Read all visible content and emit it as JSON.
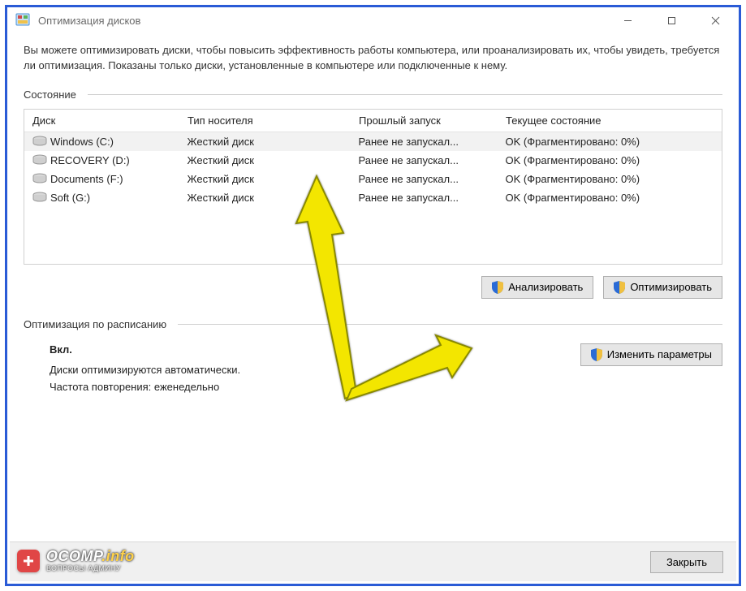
{
  "window": {
    "title": "Оптимизация дисков"
  },
  "intro": "Вы можете оптимизировать диски, чтобы повысить эффективность работы  компьютера, или проанализировать их, чтобы увидеть, требуется ли оптимизация. Показаны только диски, установленные в компьютере или подключенные к нему.",
  "section_state_label": "Состояние",
  "columns": {
    "disk": "Диск",
    "media": "Тип носителя",
    "last_run": "Прошлый запуск",
    "status": "Текущее состояние"
  },
  "drives": [
    {
      "name": "Windows (C:)",
      "media": "Жесткий диск",
      "last_run": "Ранее не запускал...",
      "status": "OK (Фрагментировано: 0%)",
      "selected": true
    },
    {
      "name": "RECOVERY (D:)",
      "media": "Жесткий диск",
      "last_run": "Ранее не запускал...",
      "status": "OK (Фрагментировано: 0%)",
      "selected": false
    },
    {
      "name": "Documents (F:)",
      "media": "Жесткий диск",
      "last_run": "Ранее не запускал...",
      "status": "OK (Фрагментировано: 0%)",
      "selected": false
    },
    {
      "name": "Soft (G:)",
      "media": "Жесткий диск",
      "last_run": "Ранее не запускал...",
      "status": "OK (Фрагментировано: 0%)",
      "selected": false
    }
  ],
  "buttons": {
    "analyze": "Анализировать",
    "optimize": "Оптимизировать",
    "change_params": "Изменить параметры",
    "close": "Закрыть"
  },
  "section_schedule_label": "Оптимизация по расписанию",
  "schedule": {
    "on": "Вкл.",
    "auto": "Диски оптимизируются автоматически.",
    "freq": "Частота повторения: еженедельно"
  },
  "watermark": {
    "brand": "OCOMP",
    "suffix": ".info",
    "tagline": "ВОПРОСЫ АДМИНУ"
  }
}
